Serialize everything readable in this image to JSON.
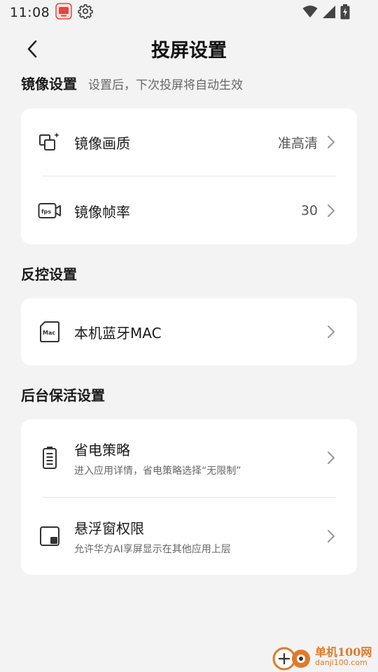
{
  "status_bar": {
    "time": "11:08"
  },
  "header": {
    "title": "投屏设置"
  },
  "sections": {
    "mirror": {
      "title": "镜像设置",
      "hint": "设置后，下次投屏将自动生效",
      "items": [
        {
          "label": "镜像画质",
          "value": "准高清"
        },
        {
          "label": "镜像帧率",
          "value": "30"
        }
      ]
    },
    "reverse_control": {
      "title": "反控设置",
      "items": [
        {
          "label": "本机蓝牙MAC"
        }
      ]
    },
    "keep_alive": {
      "title": "后台保活设置",
      "items": [
        {
          "label": "省电策略",
          "sub": "进入应用详情，省电策略选择“无限制”"
        },
        {
          "label": "悬浮窗权限",
          "sub": "允许华方AI享屏显示在其他应用上层"
        }
      ]
    }
  },
  "watermark": {
    "line1": "单机100网",
    "line2": "danji100.com"
  },
  "colors": {
    "background": "#f3f3f3",
    "card": "#ffffff",
    "accent_red": "#e8453c",
    "watermark": "#e07a2a"
  }
}
